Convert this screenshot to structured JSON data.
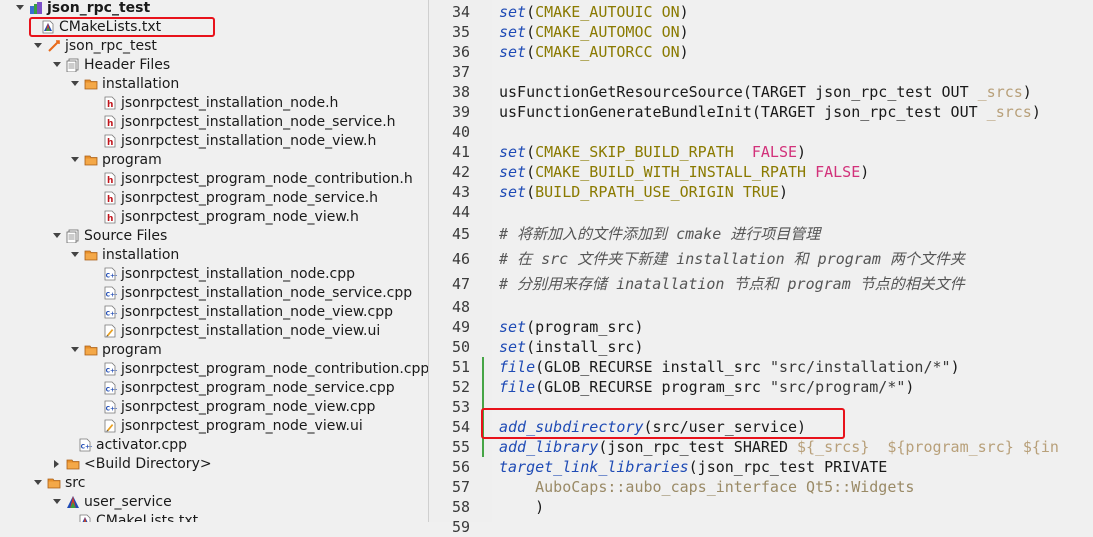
{
  "project_tree": {
    "rows": [
      {
        "label": "json_rpc_test",
        "depth": 0,
        "expand": "down",
        "icon": "project-icon",
        "bold": true
      },
      {
        "label": "CMakeLists.txt",
        "depth": 1,
        "expand": "",
        "icon": "cmake-icon"
      },
      {
        "label": "json_rpc_test",
        "depth": 1,
        "expand": "down",
        "icon": "target-icon"
      },
      {
        "label": "Header Files",
        "depth": 2,
        "expand": "down",
        "icon": "header-files-icon"
      },
      {
        "label": "installation",
        "depth": 3,
        "expand": "down",
        "icon": "folder-icon"
      },
      {
        "label": "jsonrpctest_installation_node.h",
        "depth": 4,
        "expand": "",
        "icon": "header-file-icon"
      },
      {
        "label": "jsonrpctest_installation_node_service.h",
        "depth": 4,
        "expand": "",
        "icon": "header-file-icon"
      },
      {
        "label": "jsonrpctest_installation_node_view.h",
        "depth": 4,
        "expand": "",
        "icon": "header-file-icon"
      },
      {
        "label": "program",
        "depth": 3,
        "expand": "down",
        "icon": "folder-icon"
      },
      {
        "label": "jsonrpctest_program_node_contribution.h",
        "depth": 4,
        "expand": "",
        "icon": "header-file-icon"
      },
      {
        "label": "jsonrpctest_program_node_service.h",
        "depth": 4,
        "expand": "",
        "icon": "header-file-icon"
      },
      {
        "label": "jsonrpctest_program_node_view.h",
        "depth": 4,
        "expand": "",
        "icon": "header-file-icon"
      },
      {
        "label": "Source Files",
        "depth": 2,
        "expand": "down",
        "icon": "source-files-icon"
      },
      {
        "label": "installation",
        "depth": 3,
        "expand": "down",
        "icon": "folder-icon"
      },
      {
        "label": "jsonrpctest_installation_node.cpp",
        "depth": 4,
        "expand": "",
        "icon": "cpp-file-icon"
      },
      {
        "label": "jsonrpctest_installation_node_service.cpp",
        "depth": 4,
        "expand": "",
        "icon": "cpp-file-icon"
      },
      {
        "label": "jsonrpctest_installation_node_view.cpp",
        "depth": 4,
        "expand": "",
        "icon": "cpp-file-icon"
      },
      {
        "label": "jsonrpctest_installation_node_view.ui",
        "depth": 4,
        "expand": "",
        "icon": "ui-file-icon"
      },
      {
        "label": "program",
        "depth": 3,
        "expand": "down",
        "icon": "folder-icon"
      },
      {
        "label": "jsonrpctest_program_node_contribution.cpp",
        "depth": 4,
        "expand": "",
        "icon": "cpp-file-icon"
      },
      {
        "label": "jsonrpctest_program_node_service.cpp",
        "depth": 4,
        "expand": "",
        "icon": "cpp-file-icon"
      },
      {
        "label": "jsonrpctest_program_node_view.cpp",
        "depth": 4,
        "expand": "",
        "icon": "cpp-file-icon"
      },
      {
        "label": "jsonrpctest_program_node_view.ui",
        "depth": 4,
        "expand": "",
        "icon": "ui-file-icon"
      },
      {
        "label": "activator.cpp",
        "depth": 3,
        "expand": "",
        "icon": "cpp-file-icon"
      },
      {
        "label": "<Build Directory>",
        "depth": 2,
        "expand": "right",
        "icon": "folder-icon"
      },
      {
        "label": "src",
        "depth": 1,
        "expand": "down",
        "icon": "folder-icon"
      },
      {
        "label": "user_service",
        "depth": 2,
        "expand": "down",
        "icon": "cmake-project-icon"
      },
      {
        "label": "CMakeLists.txt",
        "depth": 3,
        "expand": "",
        "icon": "cmake-icon"
      }
    ]
  },
  "editor": {
    "lines": [
      {
        "n": "34",
        "seg": [
          [
            "kw",
            "set"
          ],
          [
            "",
            "("
          ],
          [
            "const",
            "CMAKE_AUTOUIC"
          ],
          [
            "",
            " "
          ],
          [
            "const",
            "ON"
          ],
          [
            "",
            ")"
          ]
        ]
      },
      {
        "n": "35",
        "seg": [
          [
            "kw",
            "set"
          ],
          [
            "",
            "("
          ],
          [
            "const",
            "CMAKE_AUTOMOC"
          ],
          [
            "",
            " "
          ],
          [
            "const",
            "ON"
          ],
          [
            "",
            ")"
          ]
        ]
      },
      {
        "n": "36",
        "seg": [
          [
            "kw",
            "set"
          ],
          [
            "",
            "("
          ],
          [
            "const",
            "CMAKE_AUTORCC"
          ],
          [
            "",
            " "
          ],
          [
            "const",
            "ON"
          ],
          [
            "",
            ")"
          ]
        ]
      },
      {
        "n": "37",
        "seg": []
      },
      {
        "n": "38",
        "seg": [
          [
            "",
            "usFunctionGetResourceSource(TARGET json_rpc_test OUT "
          ],
          [
            "var",
            "_srcs"
          ],
          [
            "",
            ")"
          ]
        ]
      },
      {
        "n": "39",
        "seg": [
          [
            "",
            "usFunctionGenerateBundleInit(TARGET json_rpc_test OUT "
          ],
          [
            "var",
            "_srcs"
          ],
          [
            "",
            ")"
          ]
        ]
      },
      {
        "n": "40",
        "seg": []
      },
      {
        "n": "41",
        "seg": [
          [
            "kw",
            "set"
          ],
          [
            "",
            "("
          ],
          [
            "const",
            "CMAKE_SKIP_BUILD_RPATH"
          ],
          [
            "",
            "  "
          ],
          [
            "bool",
            "FALSE"
          ],
          [
            "",
            ")"
          ]
        ]
      },
      {
        "n": "42",
        "seg": [
          [
            "kw",
            "set"
          ],
          [
            "",
            "("
          ],
          [
            "const",
            "CMAKE_BUILD_WITH_INSTALL_RPATH"
          ],
          [
            "",
            " "
          ],
          [
            "bool",
            "FALSE"
          ],
          [
            "",
            ")"
          ]
        ]
      },
      {
        "n": "43",
        "seg": [
          [
            "kw",
            "set"
          ],
          [
            "",
            "("
          ],
          [
            "const",
            "BUILD_RPATH_USE_ORIGIN"
          ],
          [
            "",
            " "
          ],
          [
            "const",
            "TRUE"
          ],
          [
            "",
            ")"
          ]
        ]
      },
      {
        "n": "44",
        "seg": []
      },
      {
        "n": "45",
        "seg": [
          [
            "cmt",
            "# 将新加入的文件添加到 cmake 进行项目管理"
          ]
        ]
      },
      {
        "n": "46",
        "seg": [
          [
            "cmt",
            "# 在 src 文件夹下新建 installation 和 program 两个文件夹"
          ]
        ]
      },
      {
        "n": "47",
        "seg": [
          [
            "cmt",
            "# 分别用来存储 inatallation 节点和 program 节点的相关文件"
          ]
        ]
      },
      {
        "n": "48",
        "seg": []
      },
      {
        "n": "49",
        "seg": [
          [
            "kw",
            "set"
          ],
          [
            "",
            "(program_src)"
          ]
        ]
      },
      {
        "n": "50",
        "seg": [
          [
            "kw",
            "set"
          ],
          [
            "",
            "(install_src)"
          ]
        ]
      },
      {
        "n": "51",
        "seg": [
          [
            "kw",
            "file"
          ],
          [
            "",
            "(GLOB_RECURSE install_src "
          ],
          [
            "str",
            "\"src/installation/*\""
          ],
          [
            "",
            ")"
          ]
        ]
      },
      {
        "n": "52",
        "seg": [
          [
            "kw",
            "file"
          ],
          [
            "",
            "(GLOB_RECURSE program_src "
          ],
          [
            "str",
            "\"src/program/*\""
          ],
          [
            "",
            ")"
          ]
        ]
      },
      {
        "n": "53",
        "seg": []
      },
      {
        "n": "54",
        "seg": [
          [
            "kw",
            "add_subdirectory"
          ],
          [
            "",
            "(src/user_service)"
          ]
        ]
      },
      {
        "n": "55",
        "seg": [
          [
            "kw",
            "add_library"
          ],
          [
            "",
            "(json_rpc_test SHARED "
          ],
          [
            "var",
            "${_srcs}"
          ],
          [
            "",
            "  "
          ],
          [
            "var",
            "${program_src}"
          ],
          [
            "",
            " "
          ],
          [
            "var",
            "${in"
          ]
        ]
      },
      {
        "n": "56",
        "seg": [
          [
            "kw",
            "target_link_libraries"
          ],
          [
            "",
            "(json_rpc_test PRIVATE"
          ]
        ]
      },
      {
        "n": "57",
        "seg": [
          [
            "grey",
            "    AuboCaps::aubo_caps_interface Qt5::Widgets"
          ]
        ]
      },
      {
        "n": "58",
        "seg": [
          [
            "",
            "    )"
          ]
        ]
      },
      {
        "n": "59",
        "seg": []
      }
    ]
  }
}
